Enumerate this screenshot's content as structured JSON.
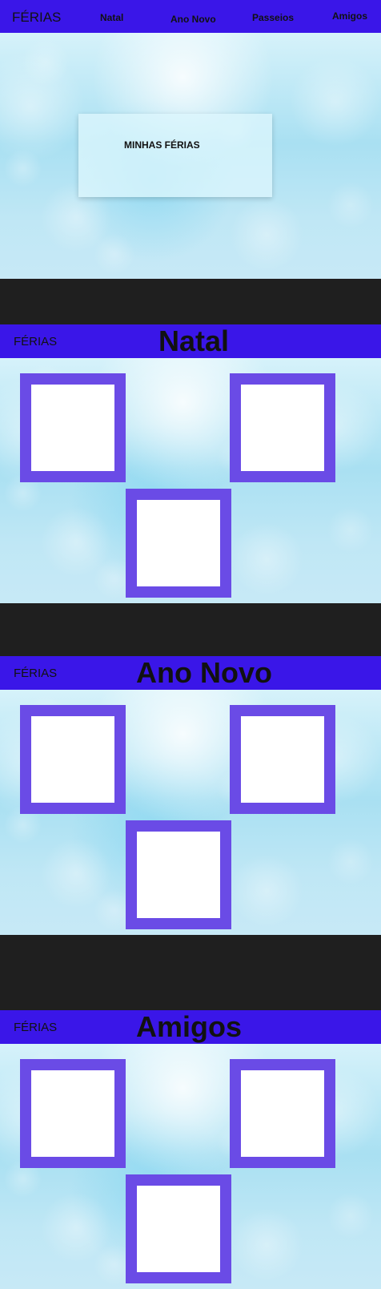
{
  "nav": {
    "brand": "FÉRIAS",
    "links": [
      {
        "label": "Natal"
      },
      {
        "label": "Ano Novo"
      },
      {
        "label": "Passeios"
      },
      {
        "label": "Amigos"
      }
    ]
  },
  "hero": {
    "title": "MINHAS FÉRIAS"
  },
  "sections": [
    {
      "brand": "FÉRIAS",
      "title": "Natal"
    },
    {
      "brand": "FÉRIAS",
      "title": "Ano Novo"
    },
    {
      "brand": "FÉRIAS",
      "title": "Amigos"
    }
  ]
}
